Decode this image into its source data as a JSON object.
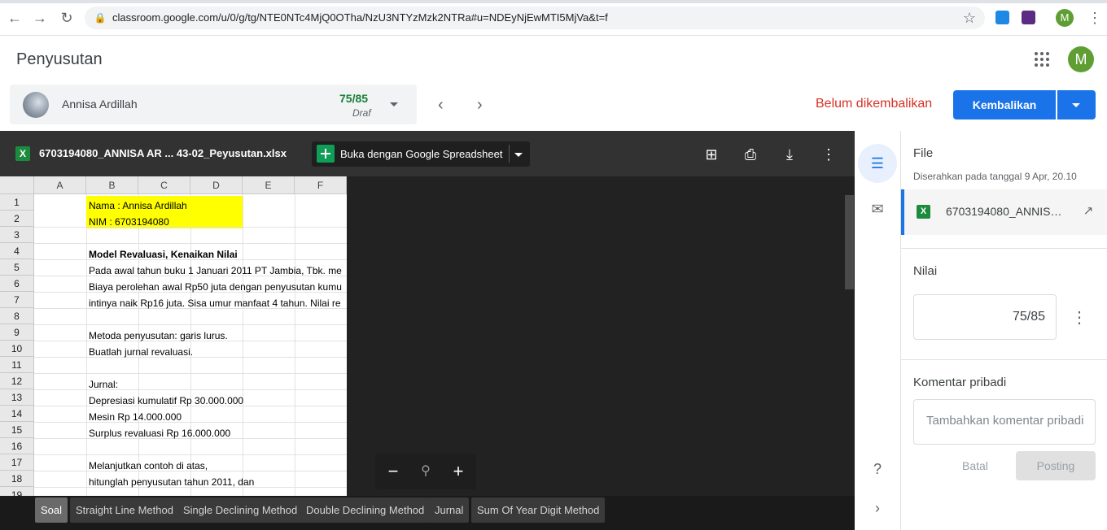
{
  "browser": {
    "url": "classroom.google.com/u/0/g/tg/NTE0NTc4MjQ0OTha/NzU3NTYzMzk2NTRa#u=NDEyNjEwMTI5MjVa&t=f",
    "profile_initial": "M"
  },
  "app": {
    "title": "Penyusutan",
    "profile_initial": "M"
  },
  "student": {
    "name": "Annisa Ardillah",
    "grade": "75/85",
    "grade_status": "Draf"
  },
  "submission": {
    "status": "Belum dikembalikan",
    "return_label": "Kembalikan",
    "status_color": "#d93025",
    "accent": "#1a73e8"
  },
  "viewer": {
    "filename": "6703194080_ANNISA AR ... 43-02_Peyusutan.xlsx",
    "open_with_label": "Buka dengan Google Spreadsheet",
    "columns": [
      "A",
      "B",
      "C",
      "D",
      "E",
      "F"
    ],
    "rows": [
      "1",
      "2",
      "3",
      "4",
      "5",
      "6",
      "7",
      "8",
      "9",
      "10",
      "11",
      "12",
      "13",
      "14",
      "15",
      "16",
      "17",
      "18",
      "19"
    ],
    "cells": {
      "r1": "Nama : Annisa Ardillah",
      "r2": "NIM  : 6703194080",
      "r4": "Model Revaluasi, Kenaikan Nilai",
      "r5": "Pada awal tahun buku 1 Januari 2011 PT Jambia, Tbk. me",
      "r6": "Biaya perolehan awal Rp50 juta dengan penyusutan kumu",
      "r7": "intinya naik Rp16 juta. Sisa umur manfaat 4 tahun. Nilai re",
      "r9": "Metoda penyusutan: garis lurus.",
      "r10": "Buatlah jurnal revaluasi.",
      "r12": "Jurnal:",
      "r13": "Depresiasi kumulatif Rp 30.000.000",
      "r14": "Mesin Rp 14.000.000",
      "r15": "Surplus revaluasi Rp 16.000.000",
      "r17": "Melanjutkan contoh di atas,",
      "r18": "hitunglah penyusutan tahun 2011, dan"
    },
    "tabs": [
      "Soal",
      "Straight Line Method",
      "Single Declining Method",
      "Double Declining Method",
      "Jurnal",
      "Sum Of Year Digit Method"
    ],
    "active_tab": "Soal"
  },
  "panel": {
    "file_title": "File",
    "submitted": "Diserahkan pada tanggal 9 Apr, 20.10",
    "file_name": "6703194080_ANNISA AR ... 43-02_Peyusutan.xlsx",
    "grade_title": "Nilai",
    "grade_value": "75/85",
    "comment_title": "Komentar pribadi",
    "comment_placeholder": "Tambahkan komentar pribadi",
    "cancel_label": "Batal",
    "post_label": "Posting"
  }
}
